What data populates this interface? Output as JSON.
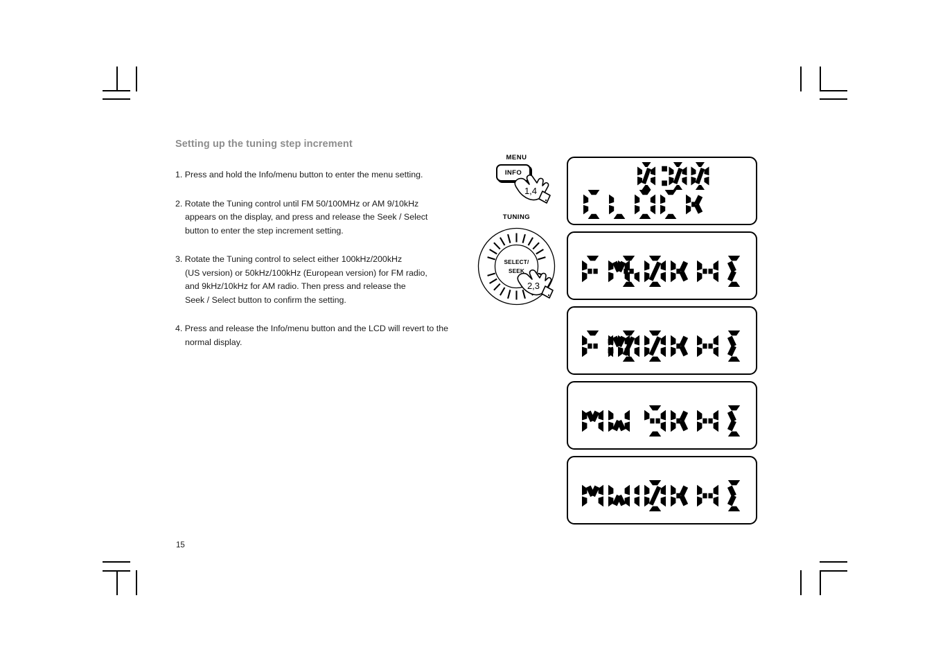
{
  "page": {
    "number": "15"
  },
  "section": {
    "title": "Setting up the tuning step increment"
  },
  "steps": [
    {
      "name": "step-1",
      "lines": [
        "1. Press and hold the Info/menu button to enter the menu setting."
      ]
    },
    {
      "name": "step-2",
      "lines": [
        "2. Rotate the Tuning control until FM 50/100MHz or AM 9/10kHz",
        "appears on the display, and press and release the Seek / Select",
        "button to enter the step increment setting."
      ]
    },
    {
      "name": "step-3",
      "lines": [
        "3. Rotate the Tuning control to select either 100kHz/200kHz",
        "(US version) or 50kHz/100kHz (European version) for FM radio,",
        "and 9kHz/10kHz for AM radio. Then press and release the",
        "Seek / Select button to confirm the setting."
      ]
    },
    {
      "name": "step-4",
      "lines": [
        "4. Press and release the Info/menu button and the LCD will revert to the",
        "normal display."
      ]
    }
  ],
  "controls": {
    "menu_label": "MENU",
    "info_button_label": "INFO",
    "tuning_label": "TUNING",
    "dial_center_line1": "SELECT/",
    "dial_center_line2": "SEEK",
    "hand_info_steps": "1,4",
    "hand_dial_steps": "2,3"
  },
  "lcd_screens": [
    {
      "name": "lcd-clock",
      "top_right": "0:00",
      "bottom_left": "CLOCK",
      "bottom_right": "",
      "layout": "clock"
    },
    {
      "name": "lcd-fm-50khz",
      "top_right": "",
      "bottom_left": "FM",
      "bottom_right": "50KHZ",
      "layout": "band"
    },
    {
      "name": "lcd-fm-100khz",
      "top_right": "",
      "bottom_left": "FM",
      "bottom_right": "100KHZ",
      "layout": "band"
    },
    {
      "name": "lcd-mw-9khz",
      "top_right": "",
      "bottom_left": "MW",
      "bottom_right": "9KHZ",
      "layout": "band"
    },
    {
      "name": "lcd-mw-10khz",
      "top_right": "",
      "bottom_left": "MW",
      "bottom_right": "10KHZ",
      "layout": "band"
    }
  ],
  "colors": {
    "title_gray": "#8d8d8d",
    "ink": "#000000",
    "background": "#ffffff"
  }
}
